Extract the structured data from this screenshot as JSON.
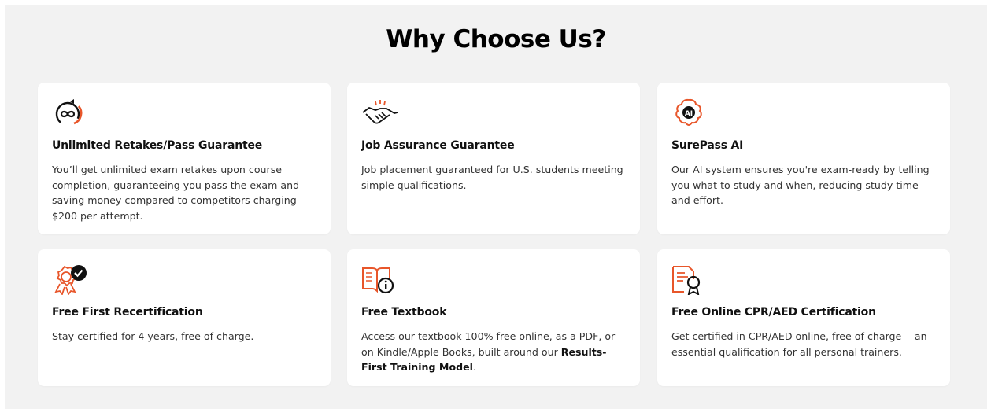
{
  "section": {
    "title": "Why Choose Us?"
  },
  "colors": {
    "accent": "#e8562a",
    "text": "#111111"
  },
  "cards": [
    {
      "icon": "infinity-retake-icon",
      "title": "Unlimited Retakes/Pass Guarantee",
      "text": "You’ll get unlimited exam retakes upon course completion, guaranteeing you pass the exam and saving money compared to competitors charging $200 per attempt."
    },
    {
      "icon": "handshake-icon",
      "title": "Job Assurance Guarantee",
      "text": "Job placement guaranteed for U.S. students meeting simple qualifications."
    },
    {
      "icon": "ai-brain-icon",
      "title": "SurePass AI",
      "text": "Our AI system ensures you're exam-ready by telling you what to study and when, reducing study time and effort."
    },
    {
      "icon": "certified-badge-icon",
      "title": "Free First Recertification",
      "text": "Stay certified for 4 years, free of charge."
    },
    {
      "icon": "book-info-icon",
      "title": "Free Textbook",
      "text_before": "Access our textbook 100% free online, as a PDF, or on Kindle/Apple Books, built around our ",
      "text_bold": "Results-First Training Model",
      "text_after": "."
    },
    {
      "icon": "certificate-award-icon",
      "title": "Free Online CPR/AED Certification",
      "text": "Get certified in CPR/AED online, free of charge —an essential qualification for all personal trainers."
    }
  ]
}
